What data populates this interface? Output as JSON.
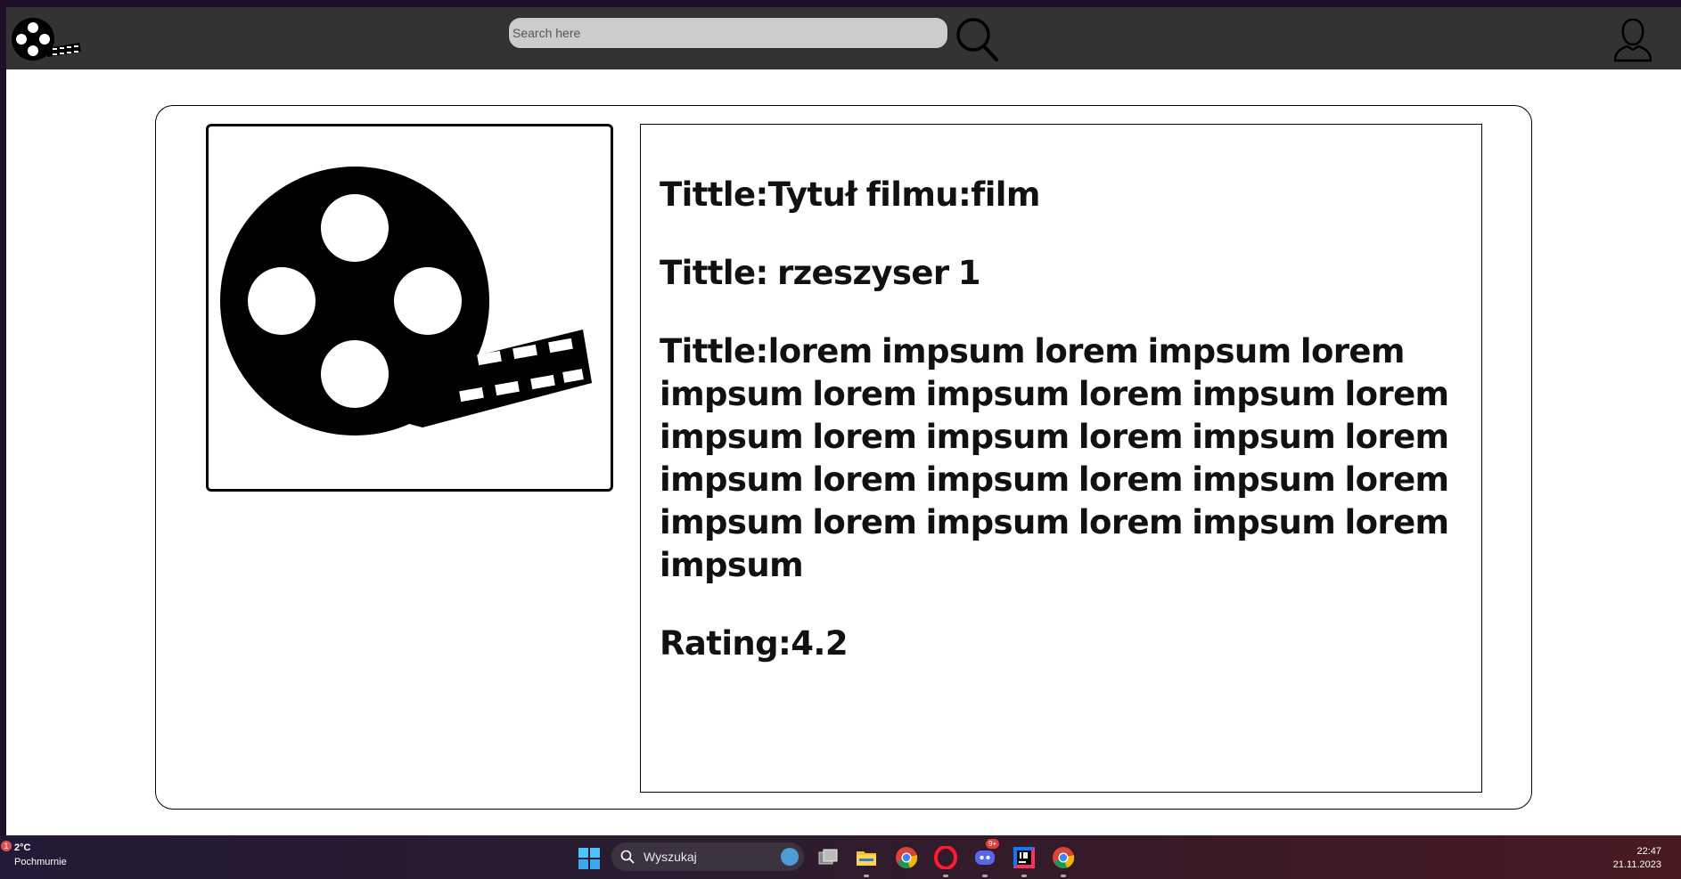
{
  "header": {
    "logo_icon": "film-reel-icon",
    "search": {
      "placeholder": "Search here",
      "value": ""
    },
    "search_icon": "magnifier-icon",
    "user_icon": "user-icon"
  },
  "movie": {
    "poster_icon": "film-reel-icon",
    "title_line": "Tittle:Tytuł filmu:film",
    "director_line": "Tittle: rzeszyser 1",
    "description_line": "Tittle:lorem impsum lorem impsum lorem impsum lorem impsum lorem impsum lorem impsum lorem impsum lorem impsum lorem impsum lorem impsum lorem impsum lorem impsum lorem impsum lorem impsum lorem impsum",
    "rating_line": "Rating:4.2"
  },
  "taskbar": {
    "weather": {
      "temp": "2°C",
      "condition": "Pochmurnie",
      "badge": "1"
    },
    "search_label": "Wyszukaj",
    "apps": [
      "windows-start-icon",
      "task-view-icon",
      "file-explorer-icon",
      "chrome-icon",
      "opera-icon",
      "discord-icon",
      "intellij-icon",
      "chrome-icon"
    ],
    "discord_badge": "9+",
    "clock": {
      "time": "22:47",
      "date": "21.11.2023"
    }
  },
  "colors": {
    "navbar_bg": "#333333",
    "search_bg": "#cccccc",
    "page_bg": "#ffffff",
    "taskbar_bg": "#2a1c30"
  }
}
